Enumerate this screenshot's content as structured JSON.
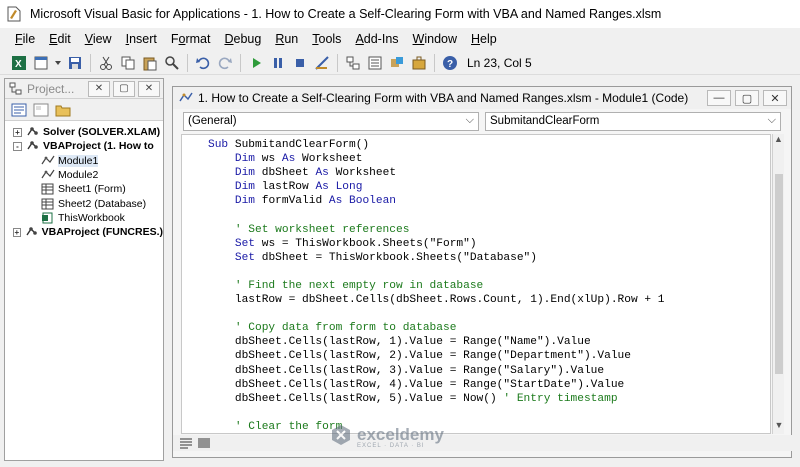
{
  "window": {
    "title": "Microsoft Visual Basic for Applications - 1. How to Create a Self-Clearing Form with VBA and Named Ranges.xlsm"
  },
  "menu": [
    {
      "label": "File",
      "key": "F"
    },
    {
      "label": "Edit",
      "key": "E"
    },
    {
      "label": "View",
      "key": "V"
    },
    {
      "label": "Insert",
      "key": "I"
    },
    {
      "label": "Format",
      "key": "o"
    },
    {
      "label": "Debug",
      "key": "D"
    },
    {
      "label": "Run",
      "key": "R"
    },
    {
      "label": "Tools",
      "key": "T"
    },
    {
      "label": "Add-Ins",
      "key": "A"
    },
    {
      "label": "Window",
      "key": "W"
    },
    {
      "label": "Help",
      "key": "H"
    }
  ],
  "toolbar": {
    "status": "Ln 23, Col 5",
    "icons": [
      "excel-icon",
      "insert-module-icon",
      "save-icon",
      "cut-icon",
      "copy-icon",
      "paste-icon",
      "find-icon",
      "undo-icon",
      "redo-icon",
      "run-icon",
      "break-icon",
      "reset-icon",
      "design-mode-icon",
      "project-explorer-icon",
      "properties-icon",
      "object-browser-icon",
      "toolbox-icon",
      "help-icon"
    ]
  },
  "project_panel": {
    "title": "Project...",
    "tree": [
      {
        "label": "Solver (SOLVER.XLAM)",
        "level": 0,
        "bold": true,
        "expander": "+",
        "icon": "vba-project-icon"
      },
      {
        "label": "VBAProject (1. How to",
        "level": 0,
        "bold": true,
        "expander": "-",
        "icon": "vba-project-icon"
      },
      {
        "label": "Module1",
        "level": 2,
        "bold": false,
        "expander": "",
        "icon": "module-icon",
        "selected": true
      },
      {
        "label": "Module2",
        "level": 2,
        "bold": false,
        "expander": "",
        "icon": "module-icon"
      },
      {
        "label": "Sheet1 (Form)",
        "level": 2,
        "bold": false,
        "expander": "",
        "icon": "sheet-icon"
      },
      {
        "label": "Sheet2 (Database)",
        "level": 2,
        "bold": false,
        "expander": "",
        "icon": "sheet-icon"
      },
      {
        "label": "ThisWorkbook",
        "level": 2,
        "bold": false,
        "expander": "",
        "icon": "workbook-icon"
      },
      {
        "label": "VBAProject (FUNCRES.)",
        "level": 0,
        "bold": true,
        "expander": "+",
        "icon": "vba-project-icon"
      }
    ]
  },
  "code_window": {
    "title": "1. How to Create a Self-Clearing Form with VBA and Named Ranges.xlsm - Module1 (Code)",
    "object_dropdown": "(General)",
    "procedure_dropdown": "SubmitandClearForm",
    "lines": [
      [
        {
          "t": "kw",
          "v": "Sub"
        },
        {
          "t": "tx",
          "v": " SubmitandClearForm()"
        }
      ],
      [
        {
          "t": "tx",
          "v": "    "
        },
        {
          "t": "kw",
          "v": "Dim"
        },
        {
          "t": "tx",
          "v": " ws "
        },
        {
          "t": "kw",
          "v": "As"
        },
        {
          "t": "tx",
          "v": " Worksheet"
        }
      ],
      [
        {
          "t": "tx",
          "v": "    "
        },
        {
          "t": "kw",
          "v": "Dim"
        },
        {
          "t": "tx",
          "v": " dbSheet "
        },
        {
          "t": "kw",
          "v": "As"
        },
        {
          "t": "tx",
          "v": " Worksheet"
        }
      ],
      [
        {
          "t": "tx",
          "v": "    "
        },
        {
          "t": "kw",
          "v": "Dim"
        },
        {
          "t": "tx",
          "v": " lastRow "
        },
        {
          "t": "kw",
          "v": "As Long"
        }
      ],
      [
        {
          "t": "tx",
          "v": "    "
        },
        {
          "t": "kw",
          "v": "Dim"
        },
        {
          "t": "tx",
          "v": " formValid "
        },
        {
          "t": "kw",
          "v": "As Boolean"
        }
      ],
      [
        {
          "t": "tx",
          "v": ""
        }
      ],
      [
        {
          "t": "tx",
          "v": "    "
        },
        {
          "t": "cm",
          "v": "' Set worksheet references"
        }
      ],
      [
        {
          "t": "tx",
          "v": "    "
        },
        {
          "t": "kw",
          "v": "Set"
        },
        {
          "t": "tx",
          "v": " ws = ThisWorkbook.Sheets(\"Form\")"
        }
      ],
      [
        {
          "t": "tx",
          "v": "    "
        },
        {
          "t": "kw",
          "v": "Set"
        },
        {
          "t": "tx",
          "v": " dbSheet = ThisWorkbook.Sheets(\"Database\")"
        }
      ],
      [
        {
          "t": "tx",
          "v": ""
        }
      ],
      [
        {
          "t": "tx",
          "v": "    "
        },
        {
          "t": "cm",
          "v": "' Find the next empty row in database"
        }
      ],
      [
        {
          "t": "tx",
          "v": "    lastRow = dbSheet.Cells(dbSheet.Rows.Count, 1).End(xlUp).Row + 1"
        }
      ],
      [
        {
          "t": "tx",
          "v": ""
        }
      ],
      [
        {
          "t": "tx",
          "v": "    "
        },
        {
          "t": "cm",
          "v": "' Copy data from form to database"
        }
      ],
      [
        {
          "t": "tx",
          "v": "    dbSheet.Cells(lastRow, 1).Value = Range(\"Name\").Value"
        }
      ],
      [
        {
          "t": "tx",
          "v": "    dbSheet.Cells(lastRow, 2).Value = Range(\"Department\").Value"
        }
      ],
      [
        {
          "t": "tx",
          "v": "    dbSheet.Cells(lastRow, 3).Value = Range(\"Salary\").Value"
        }
      ],
      [
        {
          "t": "tx",
          "v": "    dbSheet.Cells(lastRow, 4).Value = Range(\"StartDate\").Value"
        }
      ],
      [
        {
          "t": "tx",
          "v": "    dbSheet.Cells(lastRow, 5).Value = Now() "
        },
        {
          "t": "cm",
          "v": "' Entry timestamp"
        }
      ],
      [
        {
          "t": "tx",
          "v": ""
        }
      ],
      [
        {
          "t": "tx",
          "v": "    "
        },
        {
          "t": "cm",
          "v": "' Clear the form"
        }
      ]
    ]
  },
  "watermark": {
    "brand": "exceldemy",
    "tagline": "EXCEL · DATA · BI"
  },
  "colors": {
    "keyword": "#1a1aa6",
    "comment": "#1c7a1c",
    "selection": "#dde8f5"
  }
}
